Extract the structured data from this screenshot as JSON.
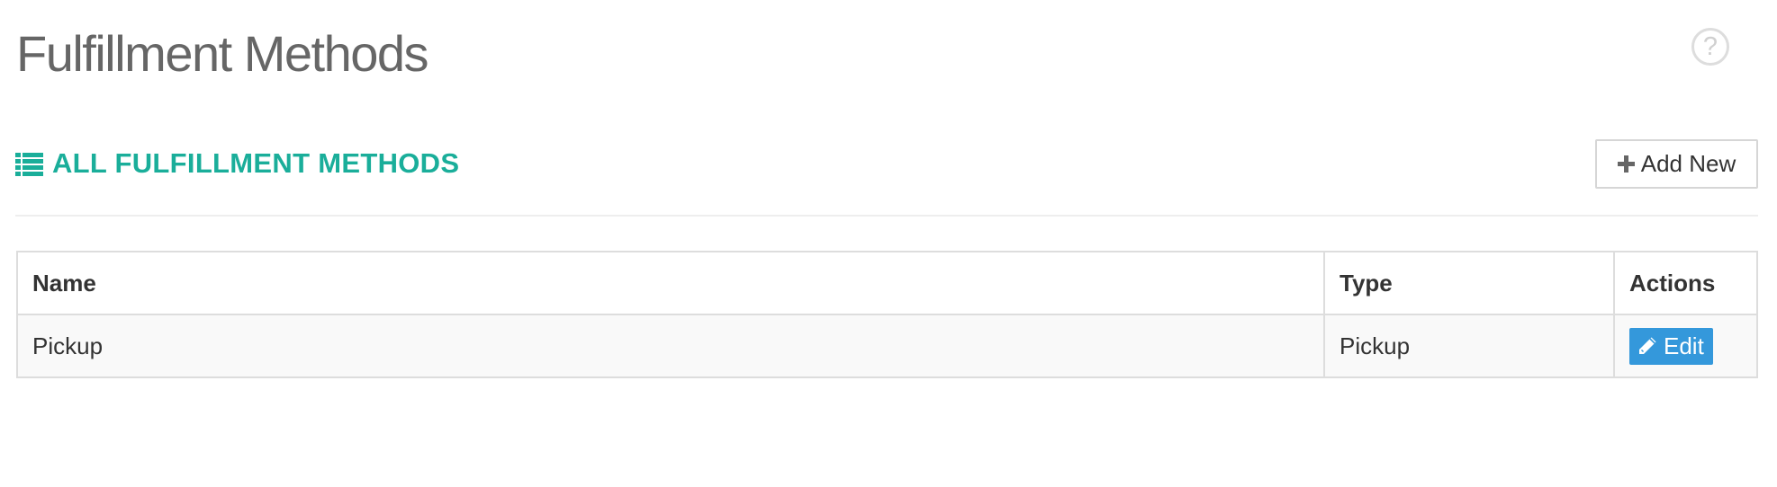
{
  "page": {
    "title": "Fulfillment Methods",
    "help_glyph": "?"
  },
  "section": {
    "title": "ALL FULFILLMENT METHODS",
    "icon": "list-icon",
    "accent_color": "#1aae9a"
  },
  "toolbar": {
    "add_new_label": "Add New",
    "add_new_icon": "plus-icon"
  },
  "table": {
    "columns": [
      "Name",
      "Type",
      "Actions"
    ],
    "rows": [
      {
        "name": "Pickup",
        "type": "Pickup",
        "action_label": "Edit",
        "action_icon": "pencil-icon"
      }
    ]
  },
  "colors": {
    "edit_button": "#3498db",
    "title_text": "#666666"
  }
}
